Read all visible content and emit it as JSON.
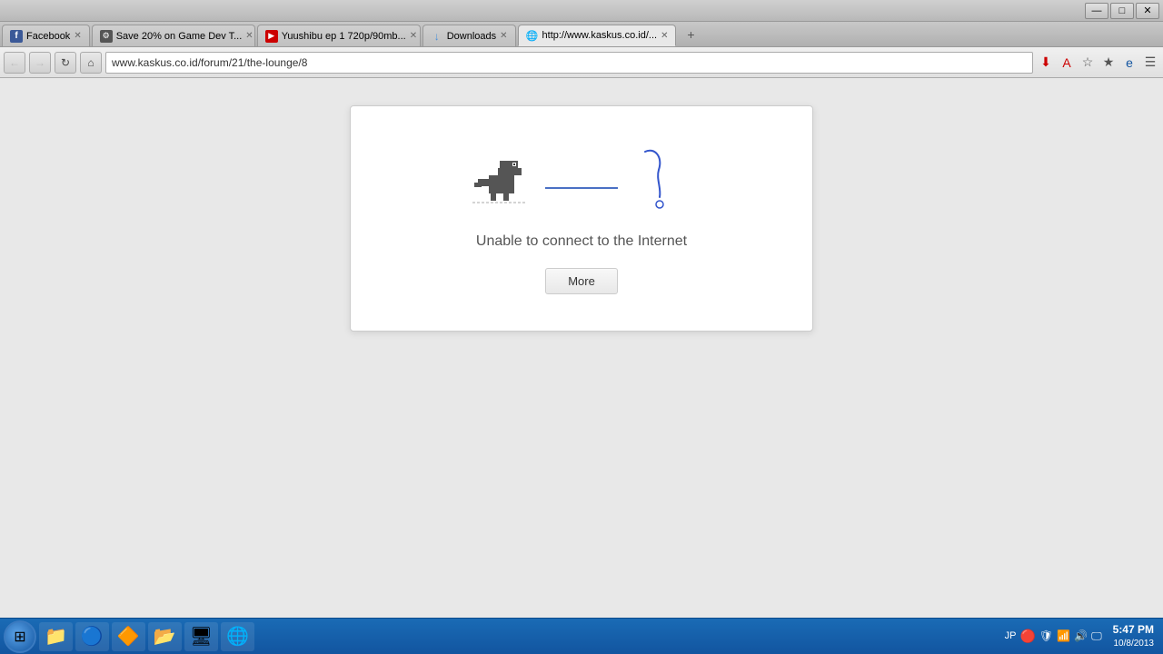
{
  "titlebar": {
    "buttons": [
      "—",
      "□",
      "✕"
    ]
  },
  "tabs": [
    {
      "id": "tab-facebook",
      "favicon": "f",
      "favicon_color": "#3b5998",
      "label": "Facebook",
      "active": false,
      "closable": true
    },
    {
      "id": "tab-gamedev",
      "favicon": "⚙",
      "favicon_color": "#999",
      "label": "Save 20% on Game Dev T...",
      "active": false,
      "closable": true
    },
    {
      "id": "tab-yuushibu",
      "favicon": "▶",
      "favicon_color": "#e00",
      "label": "Yuushibu ep 1 720p/90mb...",
      "active": false,
      "closable": true
    },
    {
      "id": "tab-downloads",
      "favicon": "↓",
      "favicon_color": "#4a90d9",
      "label": "Downloads",
      "active": false,
      "closable": true
    },
    {
      "id": "tab-kaskus",
      "favicon": "🌐",
      "favicon_color": "#999",
      "label": "http://www.kaskus.co.id/...",
      "active": true,
      "closable": true
    }
  ],
  "address_bar": {
    "url": "www.kaskus.co.id/forum/21/the-lounge/8",
    "back_title": "Back",
    "forward_title": "Forward",
    "refresh_title": "Refresh",
    "home_title": "Home"
  },
  "error_page": {
    "title": "Unable to connect to the Internet",
    "more_button": "More"
  },
  "taskbar": {
    "time": "5:47 PM",
    "date": "10/8/2013",
    "locale": "JP",
    "items": [
      {
        "id": "start",
        "icon": "⊞"
      },
      {
        "id": "explorer",
        "icon": "📁"
      },
      {
        "id": "chrome",
        "icon": "●"
      },
      {
        "id": "vlc",
        "icon": "🔶"
      },
      {
        "id": "folder2",
        "icon": "📂"
      },
      {
        "id": "task5",
        "icon": "🖥"
      },
      {
        "id": "task6",
        "icon": "🌐"
      }
    ]
  }
}
